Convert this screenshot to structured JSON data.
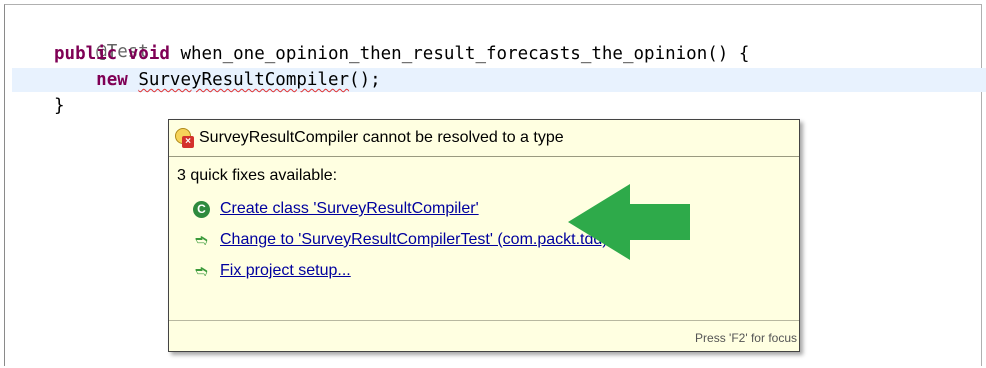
{
  "code": {
    "annotation": "@Test",
    "modifier_public": "public",
    "modifier_void": "void",
    "method_signature": " when_one_opinion_then_result_forecasts_the_opinion() {",
    "keyword_new": "new",
    "class_name": "SurveyResultCompiler",
    "call_suffix": "();",
    "closing_brace": "}"
  },
  "quickfix": {
    "error_message": "SurveyResultCompiler cannot be resolved to a type",
    "count_text": "3 quick fixes available:",
    "fixes": [
      {
        "label": "Create class 'SurveyResultCompiler'",
        "icon": "class-icon"
      },
      {
        "label": "Change to 'SurveyResultCompilerTest' (com.packt.tdd)",
        "icon": "change-icon"
      },
      {
        "label": "Fix project setup...",
        "icon": "change-icon"
      }
    ],
    "footer_hint": "Press 'F2' for focus"
  },
  "colors": {
    "keyword": "#7f0055",
    "popup_bg": "#ffffe1",
    "link": "#00009e",
    "arrow": "#2eaa4a"
  }
}
